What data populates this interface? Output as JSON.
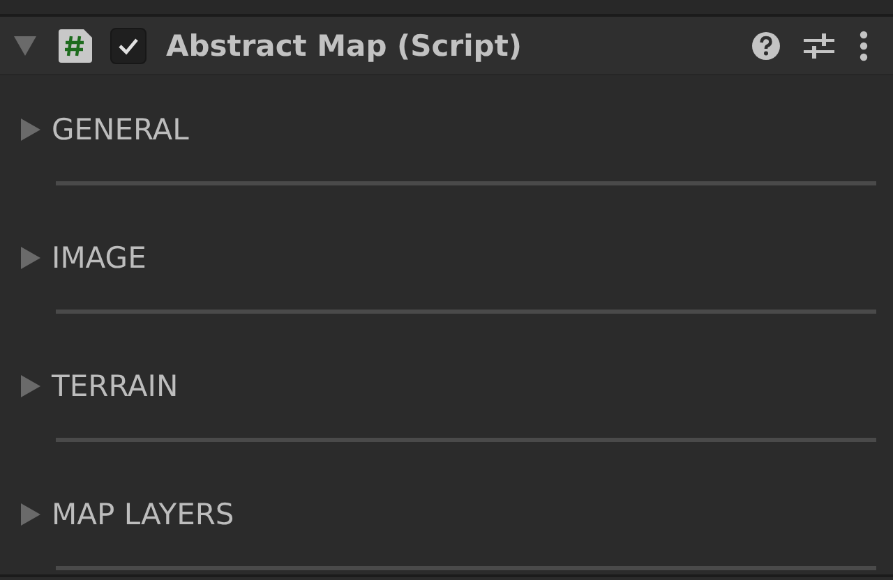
{
  "component": {
    "title": "Abstract Map (Script)",
    "expanded": true,
    "enabled": true
  },
  "sections": [
    {
      "label": "GENERAL",
      "expanded": false
    },
    {
      "label": "IMAGE",
      "expanded": false
    },
    {
      "label": "TERRAIN",
      "expanded": false
    },
    {
      "label": "MAP LAYERS",
      "expanded": false
    }
  ]
}
